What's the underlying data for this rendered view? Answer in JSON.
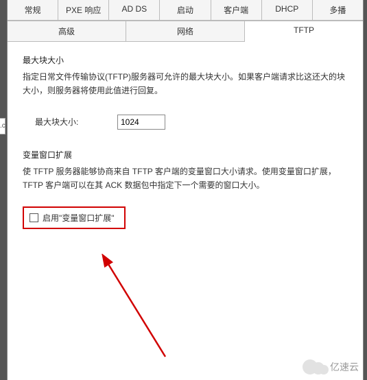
{
  "tabs": {
    "row1": [
      "常规",
      "PXE 响应",
      "AD DS",
      "启动",
      "客户端",
      "DHCP",
      "多播"
    ],
    "row2": [
      "高级",
      "网络",
      "TFTP"
    ],
    "active": "TFTP"
  },
  "section1": {
    "title": "最大块大小",
    "desc": "指定日常文件传输协议(TFTP)服务器可允许的最大块大小。如果客户端请求比这还大的块大小，则服务器将使用此值进行回复。",
    "field_label": "最大块大小:",
    "field_value": "1024"
  },
  "section2": {
    "title": "变量窗口扩展",
    "desc": "使 TFTP 服务器能够协商来自 TFTP 客户端的变量窗口大小请求。使用变量窗口扩展，TFTP 客户端可以在其 ACK 数据包中指定下一个需要的窗口大小。",
    "checkbox_label": "启用\"变量窗口扩展\"",
    "checkbox_checked": false
  },
  "watermark": "亿速云",
  "annotation": {
    "highlight_target": "enable-variable-window-checkbox",
    "arrow_color": "#d10000"
  },
  "left_marker_text": ".c"
}
